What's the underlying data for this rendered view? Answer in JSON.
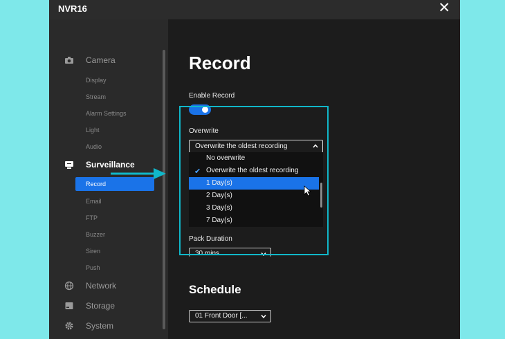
{
  "window": {
    "title": "NVR16",
    "close_icon": "close-icon"
  },
  "sidebar": {
    "sections": [
      {
        "label": "Camera",
        "icon": "camera-icon"
      },
      {
        "label": "Surveillance",
        "icon": "monitor-icon"
      },
      {
        "label": "Network",
        "icon": "globe-icon"
      },
      {
        "label": "Storage",
        "icon": "storage-icon"
      },
      {
        "label": "System",
        "icon": "gear-icon"
      }
    ],
    "camera_items": [
      "Display",
      "Stream",
      "Alarm Settings",
      "Light",
      "Audio"
    ],
    "surveillance_items": [
      "Record",
      "Email",
      "FTP",
      "Buzzer",
      "Siren",
      "Push"
    ],
    "selected": "Record"
  },
  "main": {
    "title": "Record",
    "enable_record": {
      "label": "Enable Record",
      "on": true
    },
    "overwrite": {
      "label": "Overwrite",
      "selected": "Overwrite the oldest recording",
      "options": [
        "No overwrite",
        "Overwrite the oldest recording",
        "1 Day(s)",
        "2 Day(s)",
        "3 Day(s)",
        "7 Day(s)"
      ],
      "highlighted": "1 Day(s)"
    },
    "pack_duration": {
      "label": "Pack Duration",
      "value": "30 mins"
    },
    "schedule": {
      "title": "Schedule",
      "channel": "01  Front Door [..."
    }
  },
  "colors": {
    "accent": "#1a73e8",
    "annotation": "#10b7c9"
  }
}
